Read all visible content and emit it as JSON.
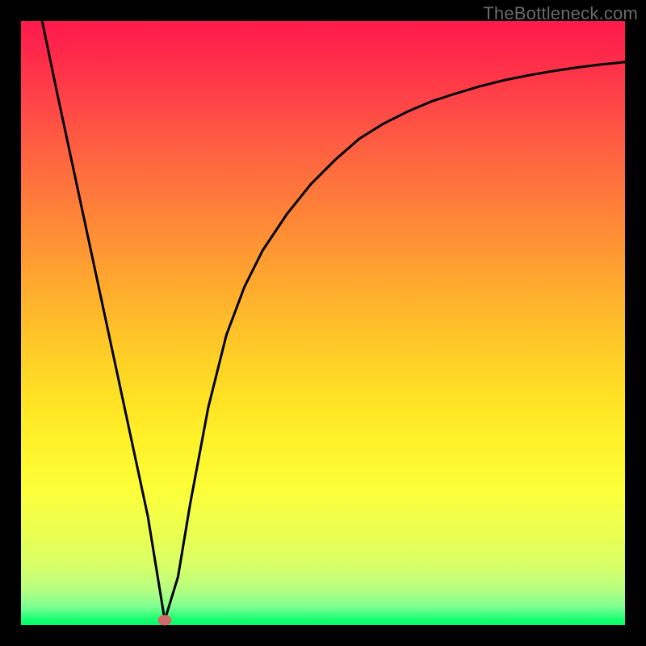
{
  "watermark": "TheBottleneck.com",
  "chart_data": {
    "type": "line",
    "title": "",
    "xlabel": "",
    "ylabel": "",
    "xlim": [
      0,
      100
    ],
    "ylim": [
      0,
      100
    ],
    "grid": false,
    "series": [
      {
        "name": "curve",
        "x": [
          3.5,
          6,
          9,
          12,
          15,
          18,
          21,
          23.8,
          26,
          28,
          31,
          34,
          37,
          40,
          44,
          48,
          52,
          56,
          60,
          64,
          68,
          72,
          76,
          80,
          84,
          88,
          92,
          96,
          100
        ],
        "y": [
          100,
          88,
          74,
          60,
          46,
          32,
          18,
          0.8,
          8,
          20,
          36,
          48,
          56,
          62,
          68,
          73,
          77,
          80.5,
          83,
          85,
          86.7,
          88,
          89.2,
          90.2,
          91,
          91.7,
          92.3,
          92.8,
          93.2
        ]
      }
    ],
    "marker": {
      "x": 23.8,
      "y": 0.8,
      "color": "#d26a6a"
    },
    "gradient_stops": [
      {
        "pos": 0,
        "color": "#ff1a4d"
      },
      {
        "pos": 50,
        "color": "#ffca27"
      },
      {
        "pos": 80,
        "color": "#fbff3a"
      },
      {
        "pos": 100,
        "color": "#00ff64"
      }
    ]
  }
}
